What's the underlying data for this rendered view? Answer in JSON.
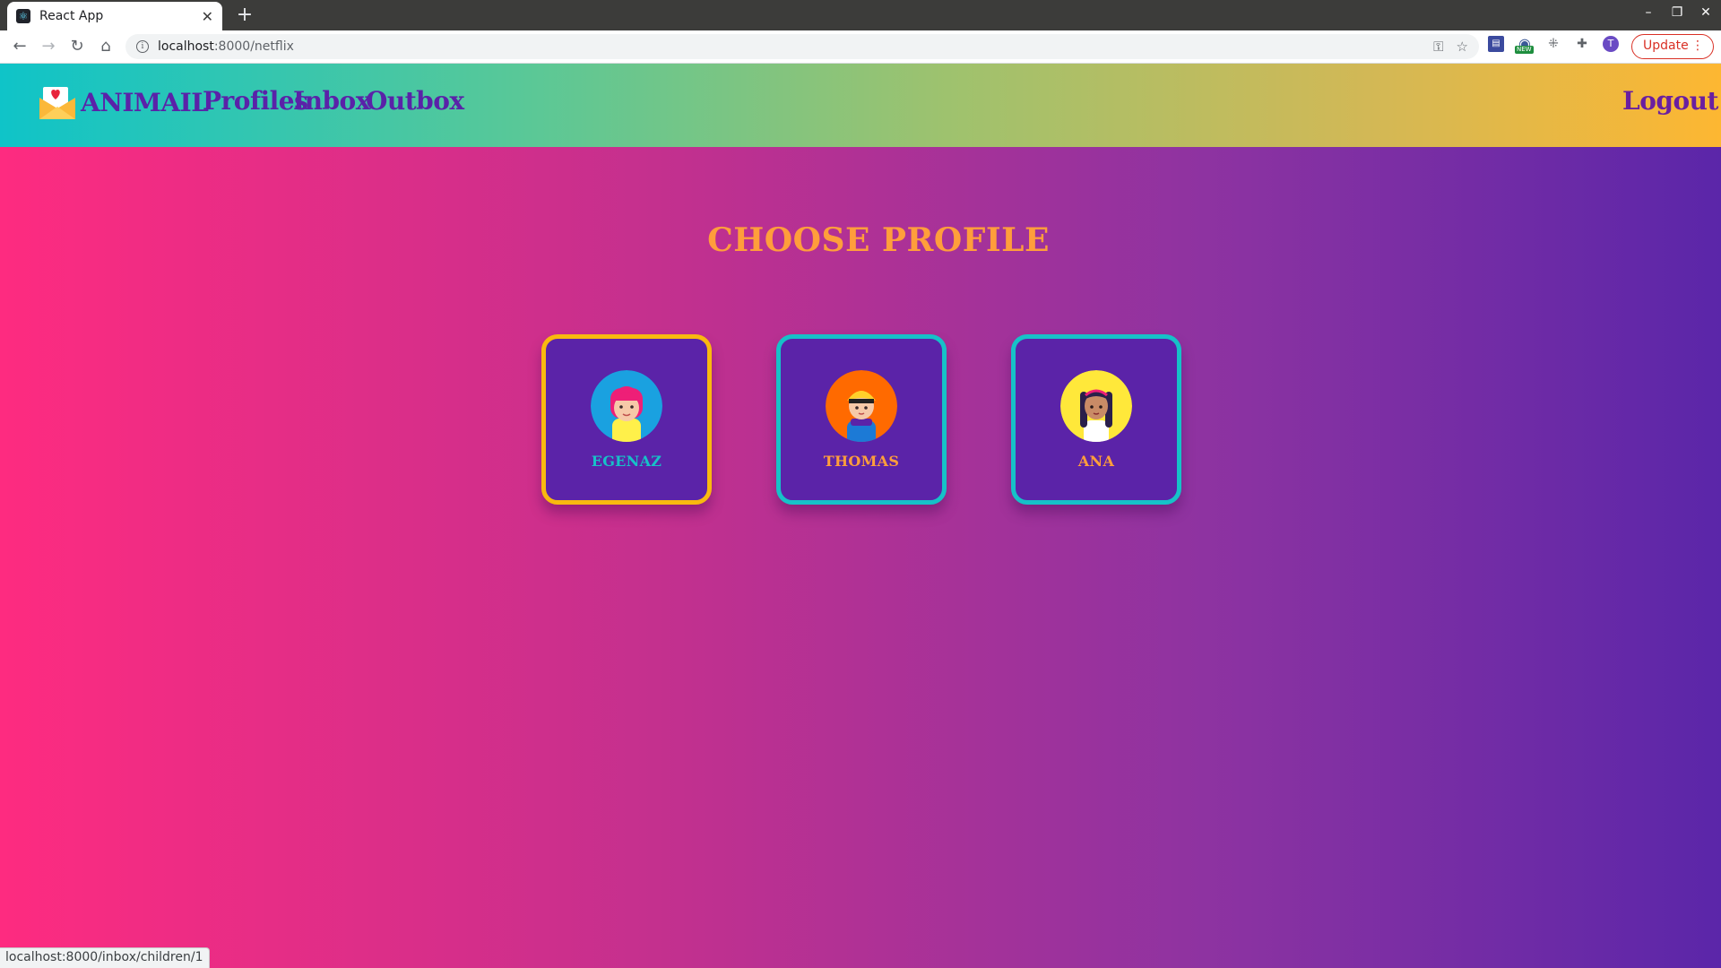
{
  "browser": {
    "tab_title": "React App",
    "tab_close": "✕",
    "new_tab": "+",
    "url_host": "localhost",
    "url_path": ":8000/netflix",
    "update_label": "Update",
    "update_menu": "⋮",
    "ext_badge": "NEW",
    "avatar_initial": "T",
    "status_url": "localhost:8000/inbox/children/1"
  },
  "header": {
    "brand": "ANIMAIL",
    "nav": [
      "Profiles",
      "Inbox",
      "Outbox"
    ],
    "logout": "Logout"
  },
  "main": {
    "title": "CHOOSE PROFILE",
    "profiles": [
      {
        "name": "EGENAZ",
        "selected": true,
        "border_color": "#f9b90f",
        "avatar_bg": "#1aa1e0"
      },
      {
        "name": "THOMAS",
        "selected": false,
        "border_color": "#16c1c8",
        "avatar_bg": "#ff6a00"
      },
      {
        "name": "ANA",
        "selected": false,
        "border_color": "#16c1c8",
        "avatar_bg": "#ffe83a"
      }
    ]
  },
  "colors": {
    "accent_orange": "#ff9e3b",
    "nav_purple": "#5a22a8",
    "card_bg": "#5b23a8",
    "card_border": "#16c1c8",
    "card_selected_border": "#f9b90f"
  }
}
